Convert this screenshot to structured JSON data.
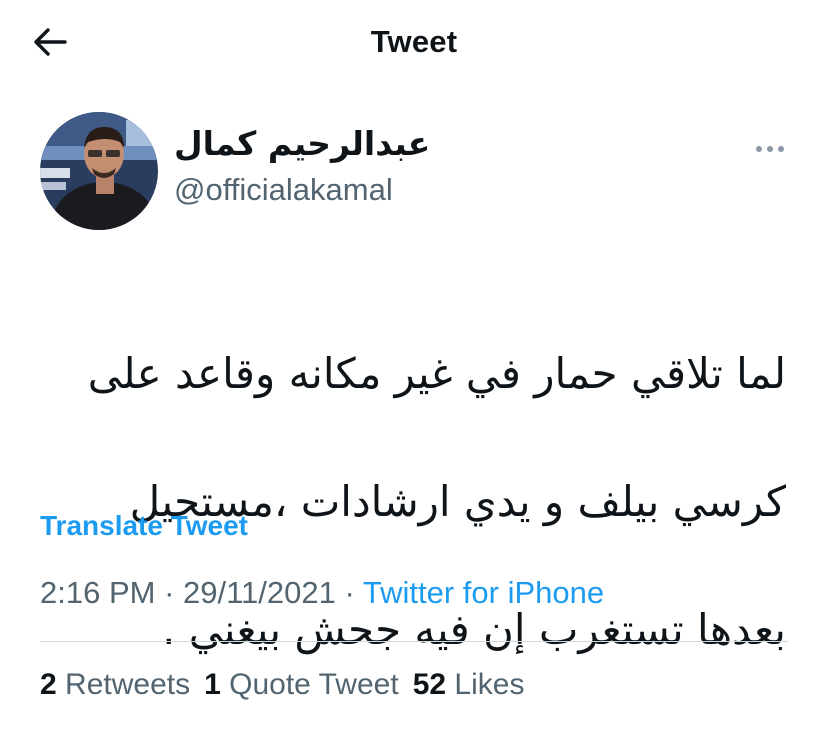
{
  "header": {
    "title": "Tweet",
    "back_icon": "arrow-left-icon"
  },
  "author": {
    "display_name": "عبدالرحيم كمال",
    "handle": "@officialakamal",
    "more_icon": "more-horizontal-icon"
  },
  "tweet": {
    "text": "لما تلاقي حمار في غير مكانه وقاعد على كرسي بيلف و يدي ارشادات ،مستحيل بعدها تستغرب إن فيه جحش بيغني .",
    "lines": [
      "لما تلاقي حمار في غير مكانه وقاعد على",
      "كرسي بيلف و يدي ارشادات ،مستحيل",
      "بعدها تستغرب إن فيه جحش بيغني ."
    ],
    "translate_label": "Translate Tweet"
  },
  "meta": {
    "time": "2:16 PM",
    "sep1": " · ",
    "date": "29/11/2021",
    "sep2": " · ",
    "source": "Twitter for iPhone"
  },
  "stats": {
    "retweets_count": "2",
    "retweets_label": "Retweets",
    "quotes_count": "1",
    "quotes_label": "Quote Tweet",
    "likes_count": "52",
    "likes_label": "Likes"
  },
  "colors": {
    "accent": "#1d9bf0",
    "secondary_text": "#536471",
    "primary_text": "#0f1419",
    "divider": "#cfd9de"
  }
}
